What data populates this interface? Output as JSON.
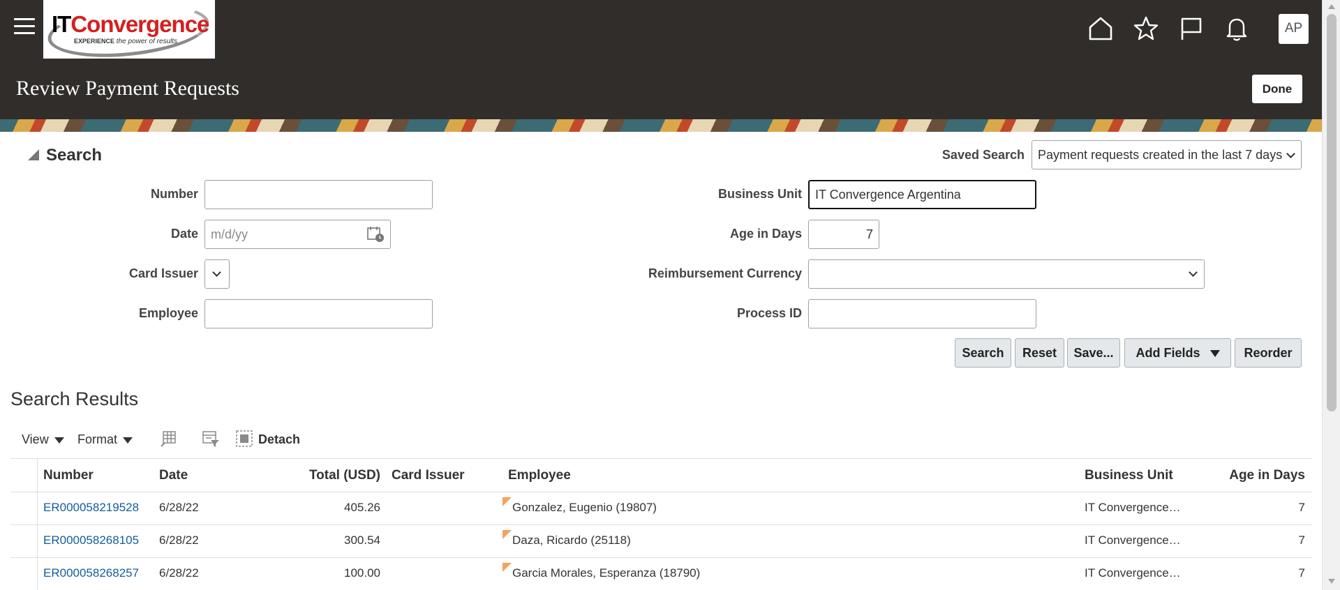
{
  "header": {
    "logo": {
      "brand_it": "IT",
      "brand_rest": "Convergence",
      "tagline_bold": "EXPERIENCE",
      "tagline": " the power of results"
    },
    "page_title": "Review Payment Requests",
    "done_label": "Done",
    "avatar_initials": "AP"
  },
  "search": {
    "title": "Search",
    "saved_search_label": "Saved Search",
    "saved_search_value": "Payment requests created in the last 7 days",
    "fields": {
      "number_label": "Number",
      "number_value": "",
      "date_label": "Date",
      "date_placeholder": "m/d/yy",
      "card_issuer_label": "Card Issuer",
      "employee_label": "Employee",
      "employee_value": "",
      "business_unit_label": "Business Unit",
      "business_unit_value": "IT Convergence Argentina",
      "age_label": "Age in Days",
      "age_value": "7",
      "currency_label": "Reimbursement Currency",
      "currency_value": "",
      "process_id_label": "Process ID",
      "process_id_value": ""
    },
    "buttons": {
      "search": "Search",
      "reset": "Reset",
      "save": "Save...",
      "add_fields": "Add Fields",
      "reorder": "Reorder"
    }
  },
  "results": {
    "title": "Search Results",
    "toolbar": {
      "view": "View",
      "format": "Format",
      "detach": "Detach"
    },
    "columns": [
      "Number",
      "Date",
      "Total (USD)",
      "Card Issuer",
      "Employee",
      "Business Unit",
      "Age in Days"
    ],
    "rows": [
      {
        "number": "ER000058219528",
        "date": "6/28/22",
        "total": "405.26",
        "card_issuer": "",
        "employee": "Gonzalez, Eugenio (19807)",
        "business_unit": "IT Convergence…",
        "age": "7"
      },
      {
        "number": "ER000058268105",
        "date": "6/28/22",
        "total": "300.54",
        "card_issuer": "",
        "employee": "Daza, Ricardo (25118)",
        "business_unit": "IT Convergence…",
        "age": "7"
      },
      {
        "number": "ER000058268257",
        "date": "6/28/22",
        "total": "100.00",
        "card_issuer": "",
        "employee": "Garcia Morales, Esperanza (18790)",
        "business_unit": "IT Convergence…",
        "age": "7"
      }
    ]
  },
  "colors": {
    "header_bg": "#312d2a",
    "link": "#145c9e",
    "flag": "#f5a25d"
  }
}
